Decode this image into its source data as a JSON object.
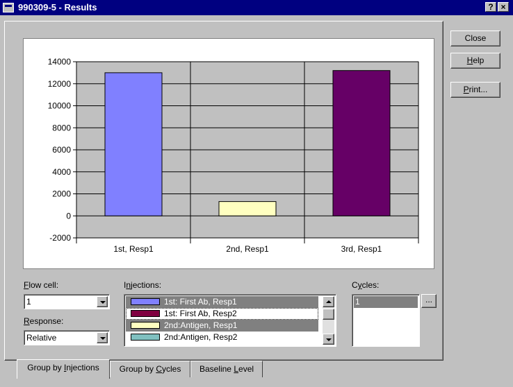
{
  "window": {
    "title": "990309-5 - Results",
    "help_glyph": "?",
    "close_glyph": "×"
  },
  "buttons": {
    "close": "Close",
    "help": "Help",
    "print": "Print..."
  },
  "controls": {
    "flow_cell_label": "Flow cell:",
    "flow_cell_value": "1",
    "response_label": "Response:",
    "response_value": "Relative",
    "injections_label": "Injections:",
    "cycles_label": "Cycles:",
    "cycles_value": "1",
    "ellipsis": "..."
  },
  "injections": [
    {
      "label": "1st: First Ab, Resp1",
      "color": "#8080ff",
      "selected": true
    },
    {
      "label": "1st: First Ab, Resp2",
      "color": "#800040",
      "selected": false,
      "focus": true
    },
    {
      "label": "2nd:Antigen, Resp1",
      "color": "#ffffc0",
      "selected": true
    },
    {
      "label": "2nd:Antigen, Resp2",
      "color": "#80c0c0",
      "selected": false
    }
  ],
  "tabs": [
    {
      "label": "Group by Injections",
      "active": true
    },
    {
      "label": "Group by Cycles",
      "active": false
    },
    {
      "label": "Baseline Level",
      "active": false
    }
  ],
  "chart_data": {
    "type": "bar",
    "categories": [
      "1st, Resp1",
      "2nd, Resp1",
      "3rd, Resp1"
    ],
    "values": [
      13000,
      1300,
      13200
    ],
    "colors": [
      "#8080ff",
      "#ffffc0",
      "#660066"
    ],
    "ylim": [
      -2000,
      14000
    ],
    "yticks": [
      -2000,
      0,
      2000,
      4000,
      6000,
      8000,
      10000,
      12000,
      14000
    ],
    "grid": true,
    "legend": "none"
  }
}
